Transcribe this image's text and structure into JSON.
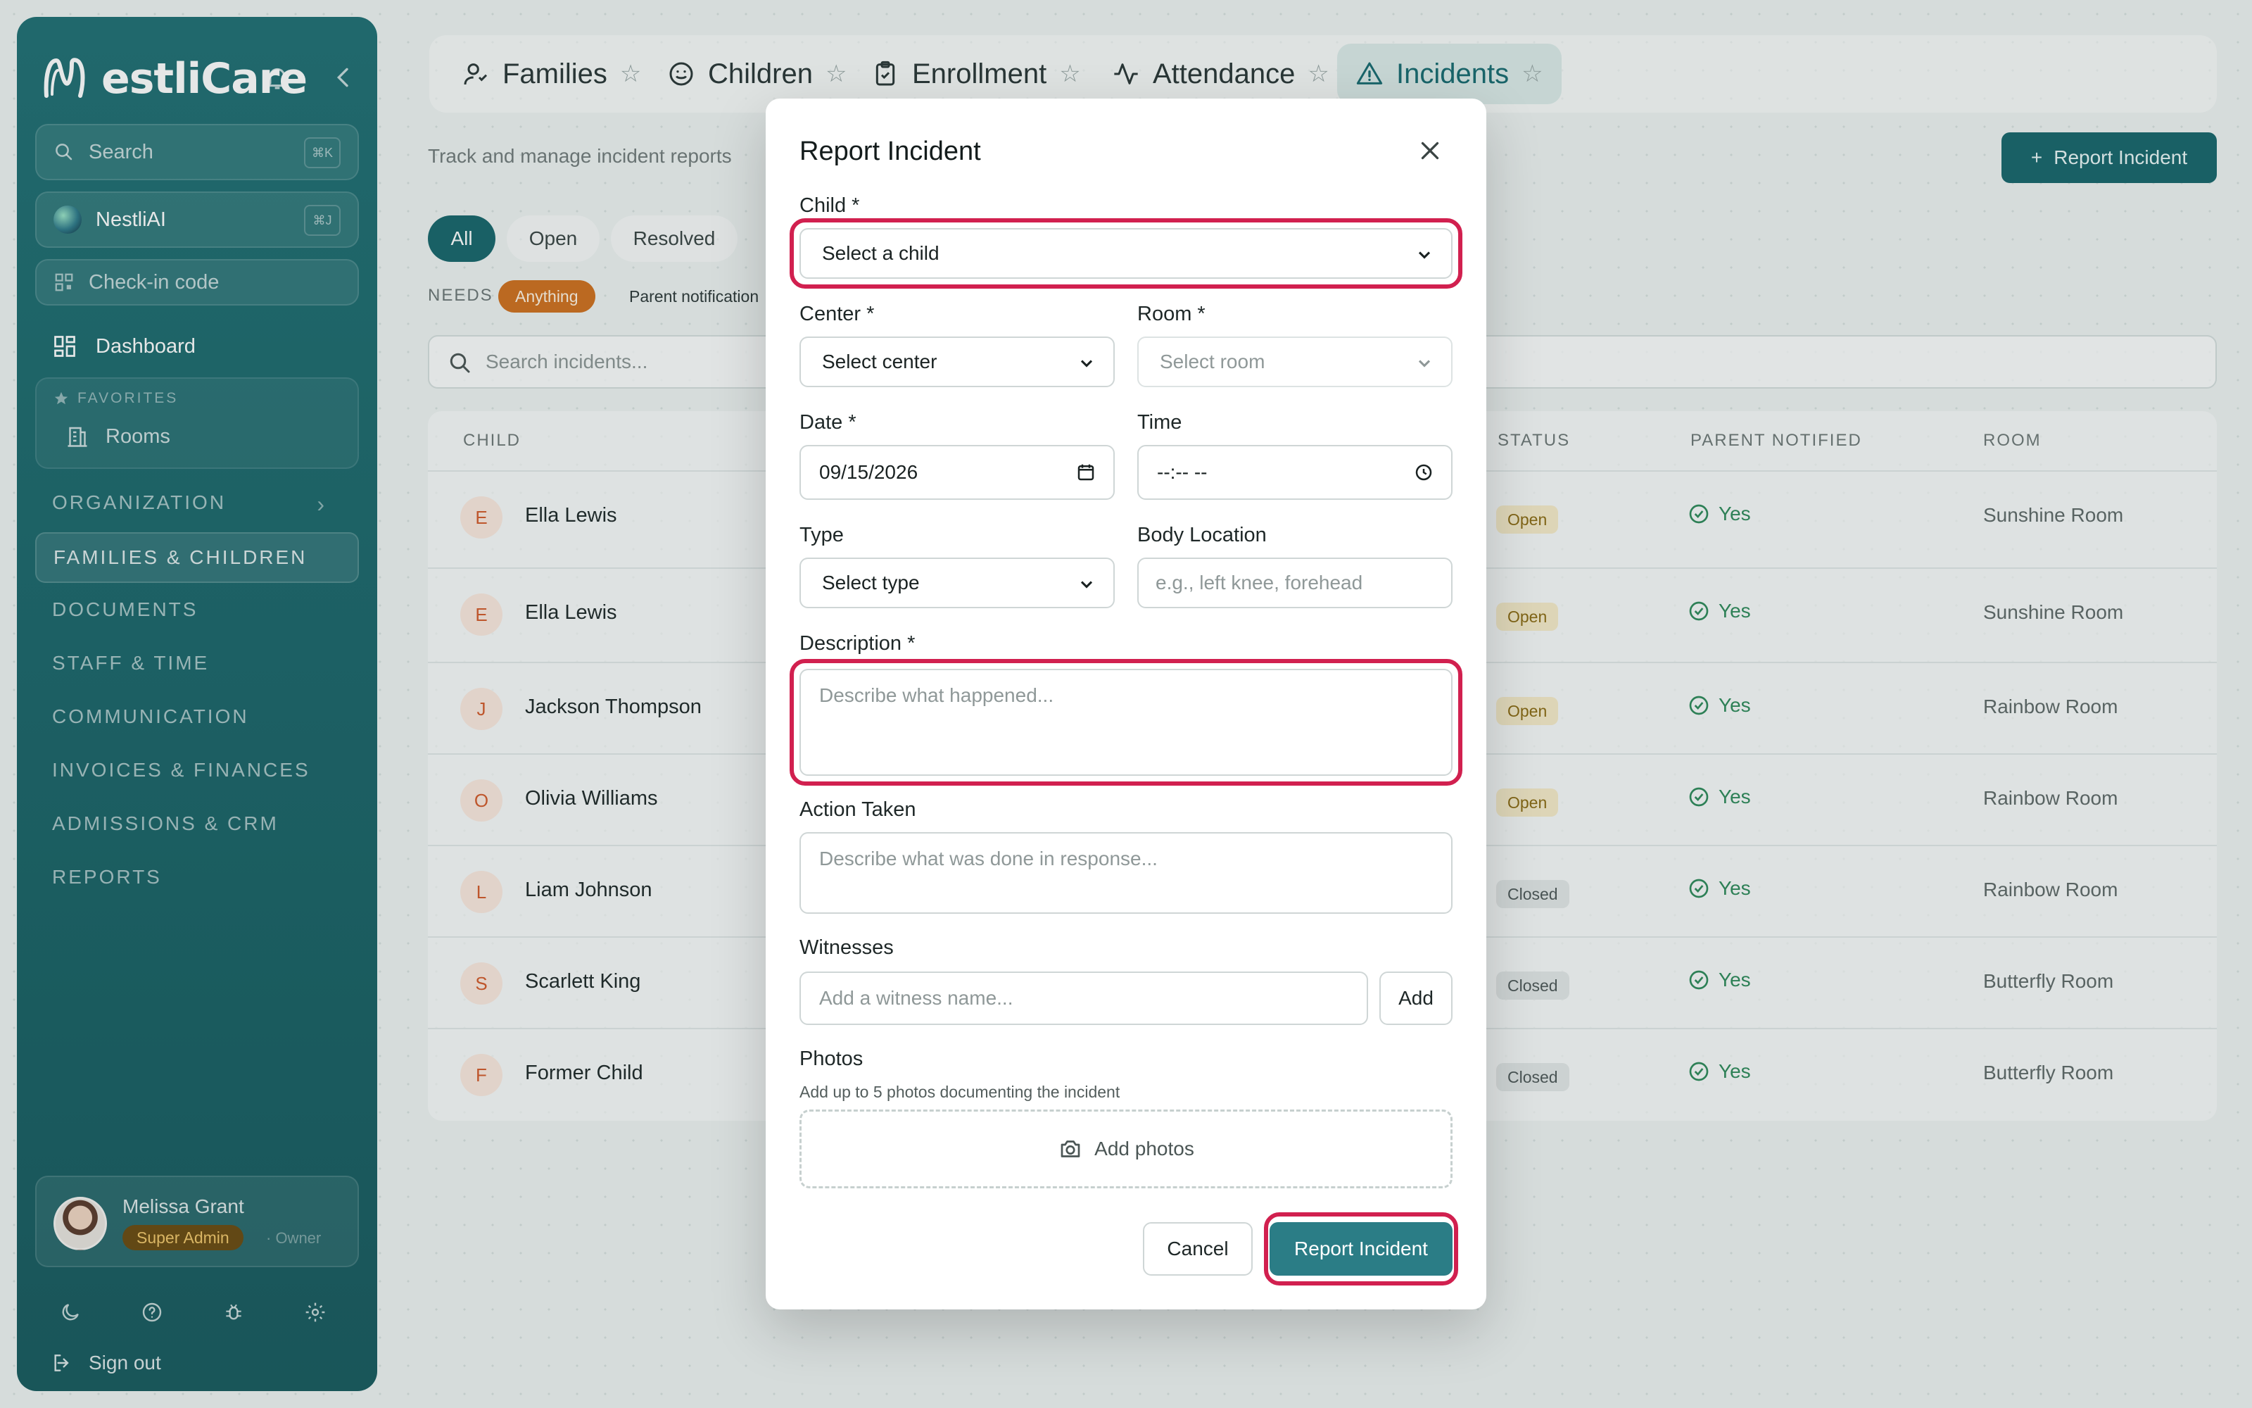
{
  "brand": {
    "name_a": "estli",
    "name_b": "Care",
    "initial": "N"
  },
  "sidebar": {
    "search": {
      "label": "Search",
      "kbd": "⌘K"
    },
    "ai": {
      "label": "NestliAI",
      "kbd": "⌘J"
    },
    "checkin": {
      "label": "Check-in code"
    },
    "dashboard": "Dashboard",
    "favorites": {
      "title": "FAVORITES",
      "items": [
        "Rooms"
      ]
    },
    "sections": [
      "ORGANIZATION",
      "FAMILIES & CHILDREN",
      "DOCUMENTS",
      "STAFF & TIME",
      "COMMUNICATION",
      "INVOICES & FINANCES",
      "ADMISSIONS & CRM",
      "REPORTS"
    ],
    "active_section": "FAMILIES & CHILDREN",
    "user": {
      "name": "Melissa Grant",
      "role": "Super Admin",
      "sub": "· Owner"
    },
    "signout": "Sign out"
  },
  "tabs": [
    {
      "label": "Families",
      "icon": "user-icon"
    },
    {
      "label": "Children",
      "icon": "smile-icon"
    },
    {
      "label": "Enrollment",
      "icon": "clipboard-icon"
    },
    {
      "label": "Attendance",
      "icon": "activity-icon"
    },
    {
      "label": "Incidents",
      "icon": "warning-icon",
      "active": true
    }
  ],
  "header": {
    "subtitle": "Track and manage incident reports",
    "report_button": "Report Incident"
  },
  "filters": {
    "chips": [
      "All",
      "Open",
      "Resolved"
    ],
    "needs_label": "NEEDS",
    "needs_chips": [
      "Anything",
      "Parent notification"
    ]
  },
  "search": {
    "placeholder": "Search incidents..."
  },
  "table": {
    "columns": {
      "child": "CHILD",
      "status": "STATUS",
      "parent_notified": "PARENT NOTIFIED",
      "room": "ROOM"
    },
    "rows": [
      {
        "initial": "E",
        "name": "Ella Lewis",
        "status": "Open",
        "notified": "Yes",
        "room": "Sunshine Room"
      },
      {
        "initial": "E",
        "name": "Ella Lewis",
        "status": "Open",
        "notified": "Yes",
        "room": "Sunshine Room"
      },
      {
        "initial": "J",
        "name": "Jackson Thompson",
        "status": "Open",
        "notified": "Yes",
        "room": "Rainbow Room"
      },
      {
        "initial": "O",
        "name": "Olivia Williams",
        "status": "Open",
        "notified": "Yes",
        "room": "Rainbow Room"
      },
      {
        "initial": "L",
        "name": "Liam Johnson",
        "status": "Closed",
        "notified": "Yes",
        "room": "Rainbow Room"
      },
      {
        "initial": "S",
        "name": "Scarlett King",
        "status": "Closed",
        "notified": "Yes",
        "room": "Butterfly Room"
      },
      {
        "initial": "F",
        "name": "Former Child",
        "status": "Closed",
        "notified": "Yes",
        "room": "Butterfly Room"
      }
    ]
  },
  "modal": {
    "title": "Report Incident",
    "child": {
      "label": "Child *",
      "value": "Select a child"
    },
    "center": {
      "label": "Center *",
      "value": "Select center"
    },
    "room": {
      "label": "Room *",
      "value": "Select room"
    },
    "date": {
      "label": "Date *",
      "value": "09/15/2026"
    },
    "time": {
      "label": "Time",
      "value": "--:-- --"
    },
    "type": {
      "label": "Type",
      "value": "Select type"
    },
    "body_location": {
      "label": "Body Location",
      "placeholder": "e.g., left knee, forehead"
    },
    "description": {
      "label": "Description *",
      "placeholder": "Describe what happened..."
    },
    "action": {
      "label": "Action Taken",
      "placeholder": "Describe what was done in response..."
    },
    "witnesses": {
      "label": "Witnesses",
      "placeholder": "Add a witness name...",
      "add": "Add"
    },
    "photos": {
      "label": "Photos",
      "hint": "Add up to 5 photos documenting the incident",
      "button": "Add photos"
    },
    "cancel": "Cancel",
    "submit": "Report Incident"
  },
  "colors": {
    "primary": "#17666b",
    "submit": "#2b7d86",
    "highlight": "#d1204f",
    "open_badge": "#f6ebc9",
    "yes": "#2e8a5a"
  }
}
